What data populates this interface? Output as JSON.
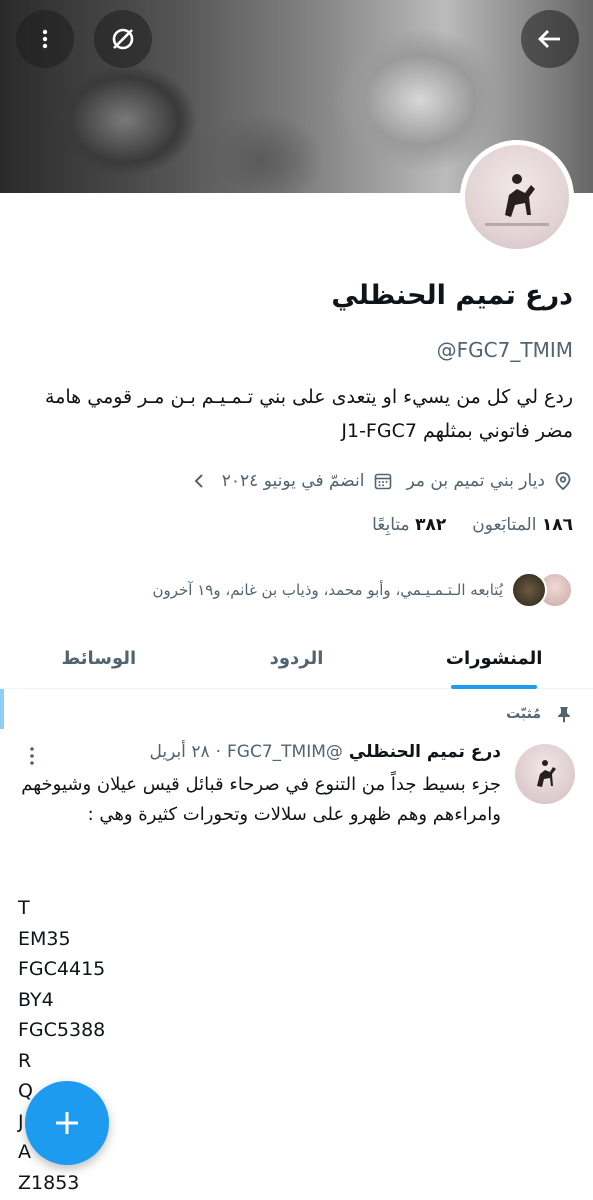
{
  "profile": {
    "name": "درع تميم الحنظلي",
    "handle": "@FGC7_TMIM",
    "bio": "ردع لي كل من يسيء او يتعدى على بني تـمـيـم بـن مـر قومي هامة مضر فاتوني بمثلهم J1-FGC7",
    "location": "ديار بني تميم بن مر",
    "joined": "انضمّ في يونيو ٢٠٢٤",
    "followers_count": "١٨٦",
    "followers_label": "المتابَعون",
    "following_count": "٣٨٢",
    "following_label": "متابِعًا",
    "followed_by_text": "يُتابعه الـتـمـيـمي، وأبو محمد، وذياب بن غانم، و١٩ آخرون"
  },
  "tabs": [
    {
      "label": "المنشورات",
      "active": true
    },
    {
      "label": "الردود",
      "active": false
    },
    {
      "label": "الوسائط",
      "active": false
    }
  ],
  "pinned_label": "مُثبّت",
  "tweet": {
    "name": "درع تميم الحنظلي",
    "handle": "@FGC7_TMIM",
    "date": "٢٨ أبريل",
    "body": "جزء بسيط جداً من التنوع في صرحاء قبائل قيس عيلان وشيوخهم وامراءهم وهم ظهرو على سلالات وتحورات كثيرة وهي :",
    "codes": [
      "T",
      "EM35",
      "FGC4415",
      "BY4",
      "FGC5388",
      "R",
      "Q",
      "J",
      "A",
      "Z1853"
    ]
  },
  "icons": {
    "back": "arrow-left-icon",
    "more": "more-vertical-icon",
    "grok": "slash-circle-icon",
    "location": "location-pin-icon",
    "calendar": "calendar-icon",
    "pin": "pin-icon",
    "fab": "plus-icon"
  },
  "colors": {
    "accent": "#1d9bf0",
    "secondary_text": "#536471",
    "primary_text": "#0f1419"
  }
}
